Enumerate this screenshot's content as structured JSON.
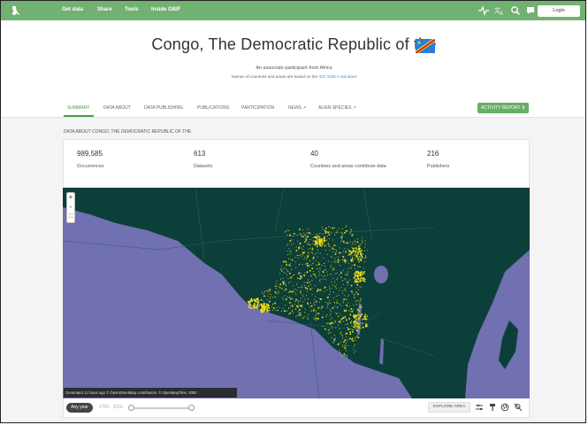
{
  "nav": {
    "items": [
      "Get data",
      "Share",
      "Tools",
      "Inside GBIF"
    ],
    "login_label": "Login",
    "icons": [
      "activity-icon",
      "translate-icon",
      "search-icon",
      "feedback-icon"
    ]
  },
  "header": {
    "title": "Congo, The Democratic Republic of the",
    "subtitle": "An associate participant from Africa",
    "iso_prefix": "Names of countries and areas are based on the",
    "iso_link": "ISO 3166-1 standard"
  },
  "tabs": {
    "items": [
      "SUMMARY",
      "DATA ABOUT",
      "DATA PUBLISHING",
      "PUBLICATIONS",
      "PARTICIPATION",
      "NEWS",
      "ALIEN SPECIES"
    ],
    "active_index": 0,
    "activity_report_label": "ACTIVITY REPORT"
  },
  "section": {
    "label": "DATA ABOUT CONGO, THE DEMOCRATIC REPUBLIC OF THE"
  },
  "stats": [
    {
      "value": "989,585",
      "label": "Occurrences"
    },
    {
      "value": "613",
      "label": "Datasets"
    },
    {
      "value": "40",
      "label": "Countries and areas contribute data"
    },
    {
      "value": "216",
      "label": "Publishers"
    }
  ],
  "map": {
    "zoom_in": "+",
    "zoom_out": "-",
    "attribution": "Generated 11 hours ago © OpenStreetMap contributors, © OpenMapTiles, GBIF."
  },
  "controls": {
    "any_year_label": "Any year",
    "year_range": "1700 - 2019",
    "explore_label": "EXPLORE AREA"
  },
  "colors": {
    "brand": "#71b171",
    "accent": "#4a9b4a",
    "land": "#0c3f3a",
    "water": "#7170b0",
    "occurrence": "#f2e21a"
  }
}
